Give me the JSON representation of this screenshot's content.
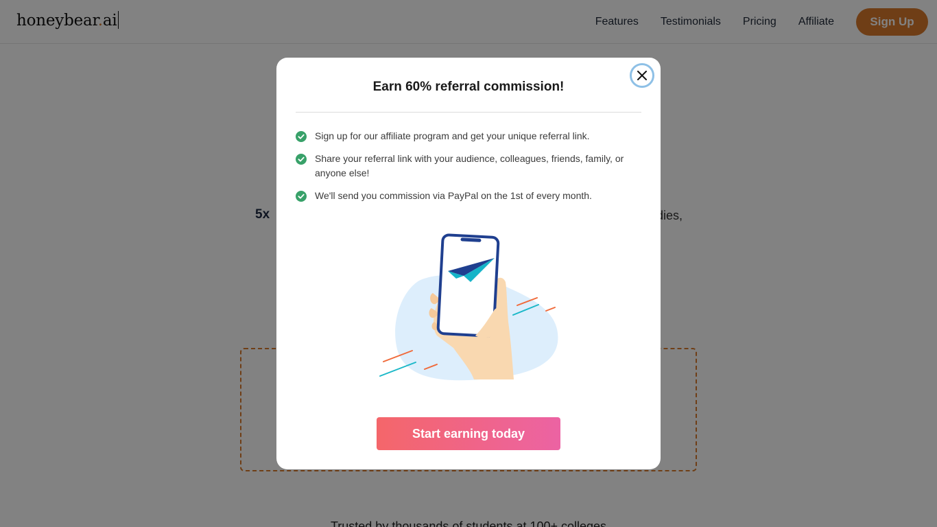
{
  "header": {
    "logo_main": "honeybear",
    "logo_dot": ".",
    "logo_ai": "ai",
    "nav": [
      {
        "label": "Features"
      },
      {
        "label": "Testimonials"
      },
      {
        "label": "Pricing"
      },
      {
        "label": "Affiliate"
      }
    ],
    "signup_label": "Sign Up"
  },
  "background": {
    "hero_sub_left": "5x",
    "hero_sub_right": "dies,",
    "trusted_text": "Trusted by thousands of students at 100+ colleges"
  },
  "modal": {
    "title": "Earn 60% referral commission!",
    "steps": [
      {
        "text": "Sign up for our affiliate program and get your unique referral link."
      },
      {
        "text": "Share your referral link with your audience, colleagues, friends, family, or anyone else!"
      },
      {
        "text": "We'll send you commission via PayPal on the 1st of every month."
      }
    ],
    "cta_label": "Start earning today"
  },
  "colors": {
    "brand_orange": "#d97a2b",
    "check_green": "#38a169",
    "cta_gradient_start": "#f4666a",
    "cta_gradient_end": "#ec63a3"
  },
  "icons": {
    "close": "close-icon",
    "check": "check-circle-icon"
  }
}
